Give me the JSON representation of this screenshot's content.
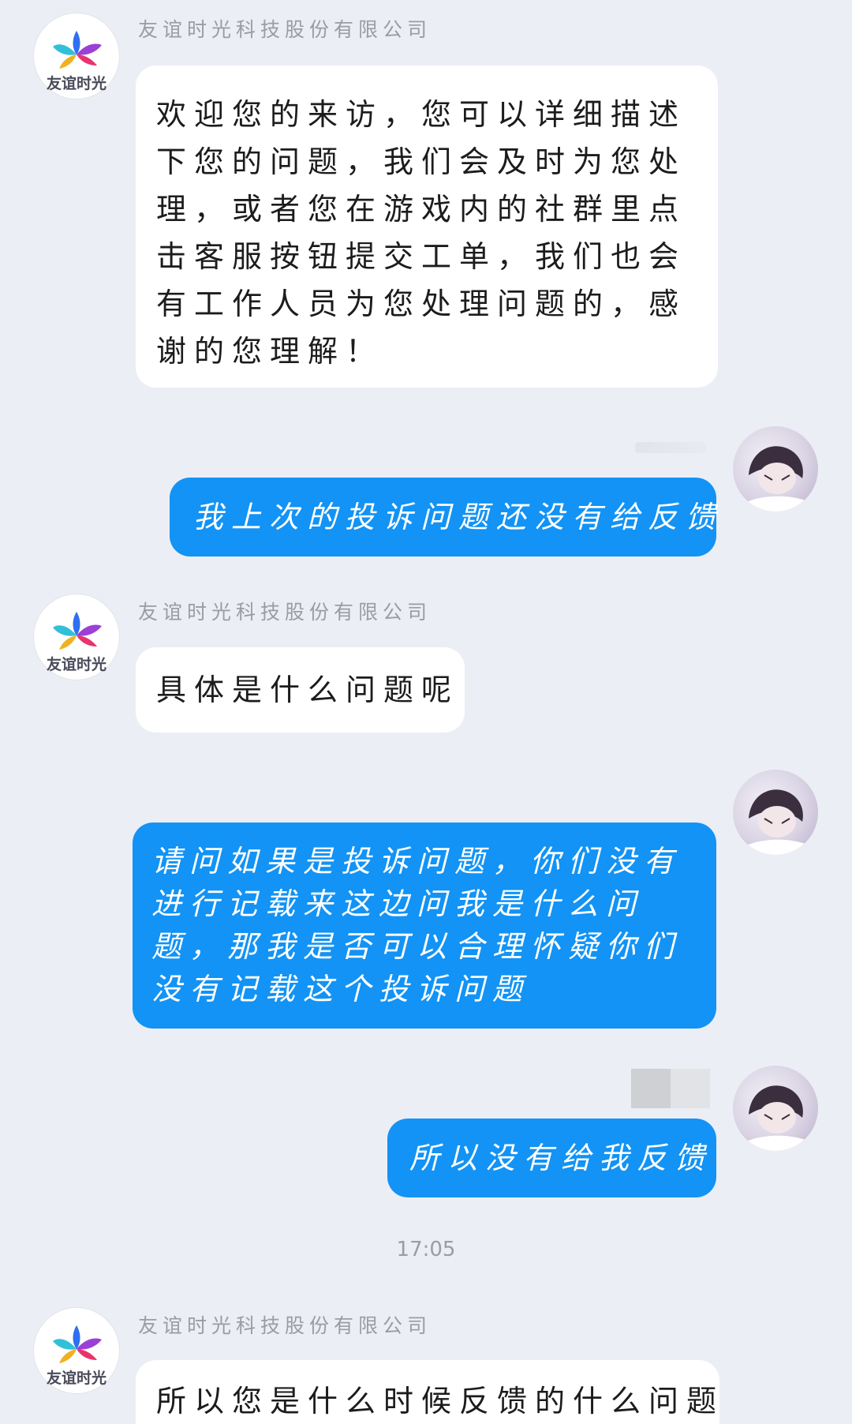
{
  "company_name": "友谊时光科技股份有限公司",
  "company_logo_text": "友谊时光",
  "timestamp": "17:05",
  "messages": [
    {
      "side": "in",
      "text": "欢迎您的来访，您可以详细描述下您的问题，我们会及时为您处理，或者您在游戏内的社群里点击客服按钮提交工单，我们也会有工作人员为您处理问题的，感谢的您理解！"
    },
    {
      "side": "out",
      "text": "我上次的投诉问题还没有给反馈"
    },
    {
      "side": "in",
      "text": "具体是什么问题呢"
    },
    {
      "side": "out",
      "text": "请问如果是投诉问题，你们没有进行记载来这边问我是什么问题，那我是否可以合理怀疑你们没有记载这个投诉问题"
    },
    {
      "side": "out",
      "text": "所以没有给我反馈"
    },
    {
      "side": "in",
      "text": "所以您是什么时候反馈的什么问题"
    }
  ],
  "colors": {
    "background": "#eceef5",
    "incoming_bubble": "#ffffff",
    "outgoing_bubble": "#1293f5"
  },
  "icons": {
    "company_avatar": "company-logo-icon",
    "user_avatar": "user-avatar-icon"
  }
}
